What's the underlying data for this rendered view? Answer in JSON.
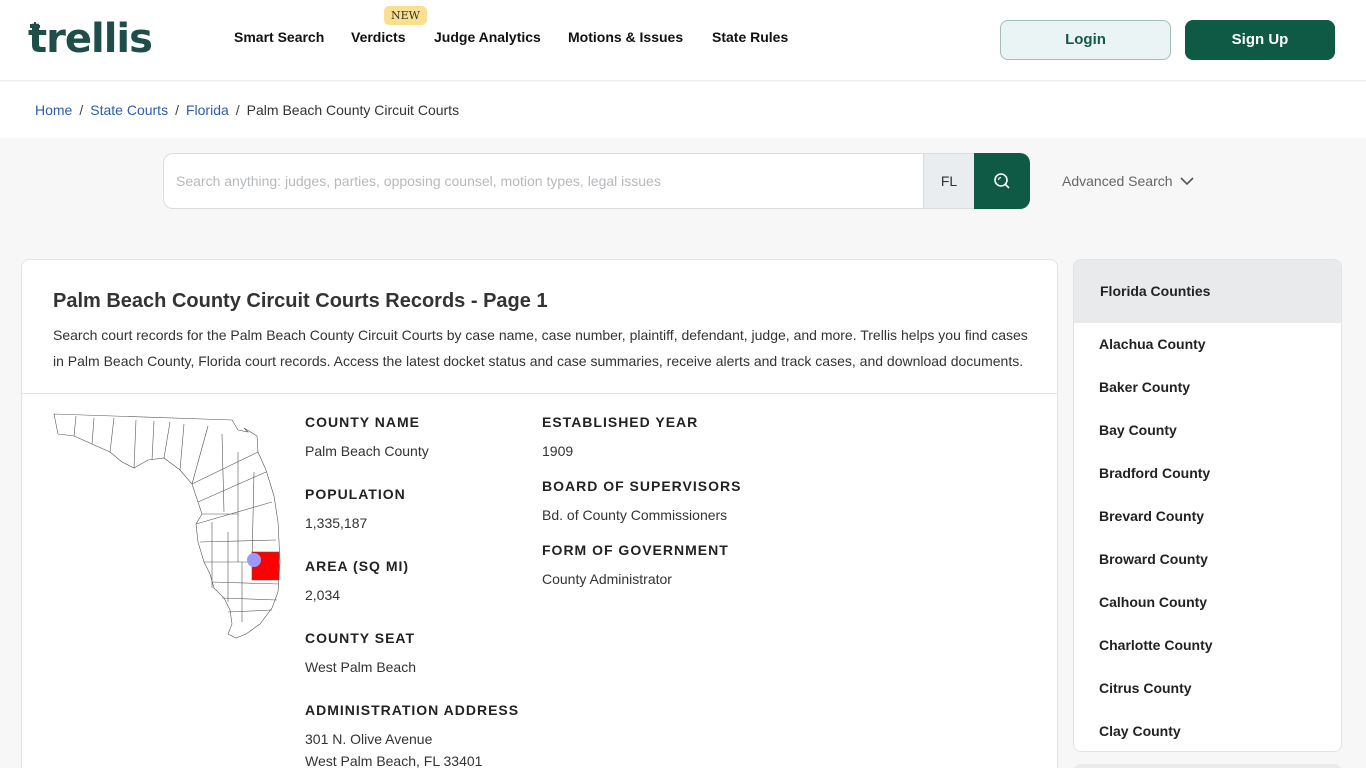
{
  "header": {
    "logo": "trellis",
    "nav": [
      {
        "label": "Smart Search"
      },
      {
        "label": "Verdicts",
        "badge": "NEW"
      },
      {
        "label": "Judge Analytics"
      },
      {
        "label": "Motions & Issues"
      },
      {
        "label": "State Rules"
      }
    ],
    "login_label": "Login",
    "signup_label": "Sign Up"
  },
  "breadcrumb": {
    "items": [
      "Home",
      "State Courts",
      "Florida"
    ],
    "separator": "/",
    "current": "Palm Beach County Circuit Courts"
  },
  "search": {
    "placeholder": "Search anything: judges, parties, opposing counsel, motion types, legal issues",
    "value": "",
    "state": "FL",
    "advanced_label": "Advanced Search"
  },
  "main": {
    "title": "Palm Beach County Circuit Courts Records - Page 1",
    "description": "Search court records for the Palm Beach County Circuit Courts by case name, case number, plaintiff, defendant, judge, and more. Trellis helps you find cases in Palm Beach County, Florida court records. Access the latest docket status and case summaries, receive alerts and track cases, and download documents.",
    "info": {
      "county_name": {
        "label": "County Name",
        "value": "Palm Beach County"
      },
      "population": {
        "label": "Population",
        "value": "1,335,187"
      },
      "area": {
        "label": "Area (sq mi)",
        "value": "2,034"
      },
      "county_seat": {
        "label": "County Seat",
        "value": "West Palm Beach"
      },
      "admin_address": {
        "label": "Administration Address",
        "line1": "301 N. Olive Avenue",
        "line2": "West Palm Beach, FL 33401"
      },
      "established": {
        "label": "Established Year",
        "value": "1909"
      },
      "board": {
        "label": "Board of Supervisors",
        "value": "Bd. of County Commissioners"
      },
      "government": {
        "label": "Form of Government",
        "value": "County Administrator"
      }
    }
  },
  "sidebar": {
    "title": "Florida Counties",
    "counties": [
      "Alachua County",
      "Baker County",
      "Bay County",
      "Bradford County",
      "Brevard County",
      "Broward County",
      "Calhoun County",
      "Charlotte County",
      "Citrus County",
      "Clay County"
    ]
  },
  "colors": {
    "brand_green": "#0e5a44",
    "link_blue": "#2c5cab",
    "highlight_county": "#ff0000",
    "lake": "#9999ff",
    "badge_yellow": "#f8e08e"
  }
}
